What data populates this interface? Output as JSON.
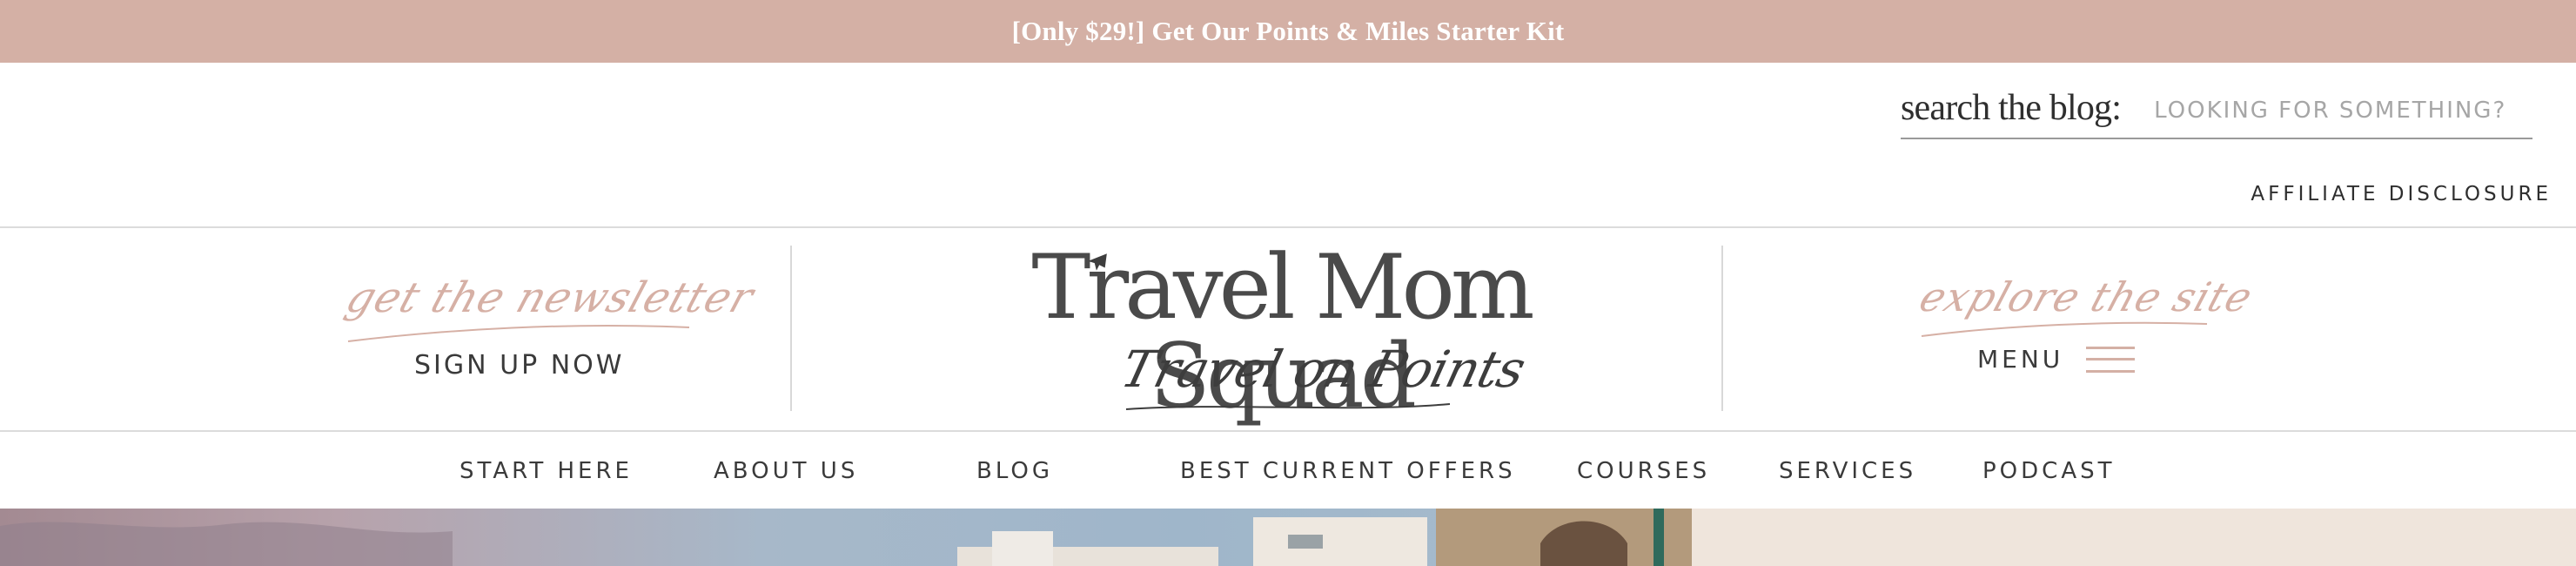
{
  "promo": {
    "text": "[Only $29!] Get Our Points & Miles Starter Kit"
  },
  "search": {
    "label": "search the blog:",
    "placeholder": "LOOKING FOR SOMETHING?"
  },
  "header_links": {
    "affiliate": "AFFILIATE DISCLOSURE"
  },
  "newsletter": {
    "script": "get the newsletter",
    "cta": "SIGN UP NOW"
  },
  "logo": {
    "title": "Travel Mom Squad",
    "tagline": "Travel on Points"
  },
  "explore": {
    "script": "explore the site",
    "menu_label": "MENU"
  },
  "nav": {
    "items": [
      {
        "label": "START HERE"
      },
      {
        "label": "ABOUT US"
      },
      {
        "label": "BLOG"
      },
      {
        "label": "BEST CURRENT OFFERS"
      },
      {
        "label": "COURSES"
      },
      {
        "label": "SERVICES"
      },
      {
        "label": "PODCAST"
      }
    ]
  },
  "colors": {
    "accent": "#d4b0a5",
    "text_dark": "#3d3d3d",
    "side_panel": "#efe5dc"
  },
  "icons": {
    "logo_mark": "airplane-icon",
    "menu": "hamburger-icon"
  }
}
